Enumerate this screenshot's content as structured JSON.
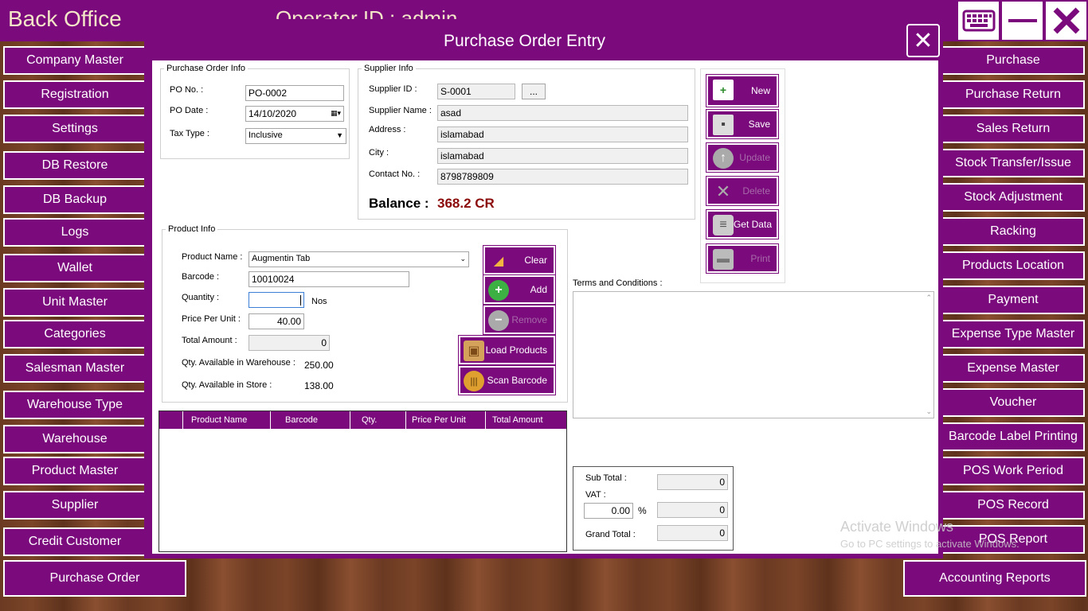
{
  "app": {
    "title": "Back Office",
    "operator": "Operator ID : admin"
  },
  "window_controls": {
    "keyboard": "keyboard-icon",
    "minimize": "minimize-icon",
    "close": "close-icon"
  },
  "left_menu": [
    "Company Master",
    "Registration",
    "Settings",
    "DB Restore",
    "DB Backup",
    "Logs",
    "Wallet",
    "Unit Master",
    "Categories",
    "Salesman Master",
    "Warehouse Type",
    "Warehouse",
    "Product Master",
    "Supplier",
    "Credit Customer",
    "Purchase Order"
  ],
  "right_menu": [
    "Purchase",
    "Purchase Return",
    "Sales Return",
    "Stock Transfer/Issue",
    "Stock Adjustment",
    "Racking",
    "Products Location",
    "Payment",
    "Expense Type Master",
    "Expense Master",
    "Voucher",
    "Barcode Label Printing",
    "POS Work Period",
    "POS Record",
    "POS Report",
    "Accounting Reports"
  ],
  "dialog": {
    "title": "Purchase Order Entry",
    "po_info": {
      "legend": "Purchase Order Info",
      "po_no_label": "PO No. :",
      "po_no": "PO-0002",
      "po_date_label": "PO Date :",
      "po_date": "14/10/2020",
      "tax_type_label": "Tax Type :",
      "tax_type": "Inclusive"
    },
    "supplier_info": {
      "legend": "Supplier Info",
      "id_label": "Supplier ID :",
      "id": "S-0001",
      "browse": "...",
      "name_label": "Supplier Name :",
      "name": "asad",
      "address_label": "Address :",
      "address": "islamabad",
      "city_label": "City :",
      "city": "islamabad",
      "contact_label": "Contact No. :",
      "contact": "8798789809",
      "balance_label": "Balance :",
      "balance": "368.2 CR"
    },
    "actions": {
      "new": "New",
      "save": "Save",
      "update": "Update",
      "delete": "Delete",
      "get_data": "Get Data",
      "print": "Print"
    },
    "product_info": {
      "legend": "Product Info",
      "name_label": "Product Name :",
      "name": "Augmentin Tab",
      "barcode_label": "Barcode :",
      "barcode": "10010024",
      "qty_label": "Quantity :",
      "qty": "",
      "unit": "Nos",
      "price_label": "Price Per Unit :",
      "price": "40.00",
      "total_label": "Total Amount :",
      "total": "0",
      "wh_label": "Qty. Available in Warehouse :",
      "wh_qty": "250.00",
      "store_label": "Qty. Available in Store :",
      "store_qty": "138.00"
    },
    "product_buttons": {
      "clear": "Clear",
      "add": "Add",
      "remove": "Remove",
      "load": "Load Products",
      "scan": "Scan Barcode"
    },
    "grid_columns": [
      "Product Name",
      "Barcode",
      "Qty.",
      "Price Per Unit",
      "Total Amount"
    ],
    "terms_label": "Terms and Conditions :",
    "totals": {
      "sub_total_label": "Sub Total :",
      "sub_total": "0",
      "vat_label": "VAT :",
      "vat_pct": "0.00",
      "pct": "%",
      "vat_amount": "0",
      "grand_total_label": "Grand Total :",
      "grand_total": "0"
    }
  },
  "watermark": {
    "line1": "Activate Windows",
    "line2": "Go to PC settings to activate Windows."
  },
  "colors": {
    "accent": "#7b0a7d",
    "balance": "#8b0a0a"
  }
}
